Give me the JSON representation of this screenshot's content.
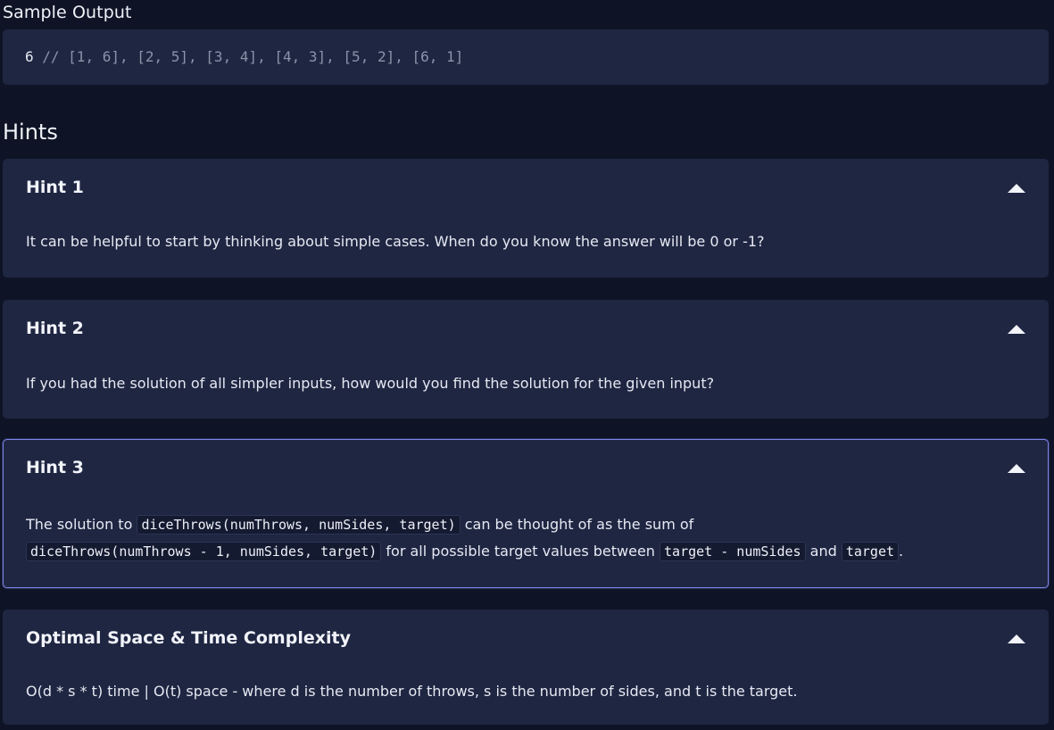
{
  "sample_output": {
    "label": "Sample Output",
    "code_value": "6",
    "code_comment": " // [1, 6], [2, 5], [3, 4], [4, 3], [5, 2], [6, 1]"
  },
  "hints": {
    "heading": "Hints",
    "hint1": {
      "title": "Hint 1",
      "text": "It can be helpful to start by thinking about simple cases. When do you know the answer will be 0 or -1?"
    },
    "hint2": {
      "title": "Hint 2",
      "text": "If you had the solution of all simpler inputs, how would you find the solution for the given input?"
    },
    "hint3": {
      "title": "Hint 3",
      "text_1": "The solution to ",
      "code_1": "diceThrows(numThrows, numSides, target)",
      "text_2": " can be thought of as the sum of ",
      "code_2": "diceThrows(numThrows - 1, numSides, target)",
      "text_3": " for all possible target values between ",
      "code_3": "target - numSides",
      "text_4": " and ",
      "code_4": "target",
      "text_5": "."
    },
    "complexity": {
      "title": "Optimal Space & Time Complexity",
      "text": "O(d * s * t) time | O(t) space - where d is the number of throws, s is the number of sides, and t is the target."
    }
  },
  "icons": {
    "toggle": "caret-up-icon"
  },
  "colors": {
    "background": "#0e1426",
    "card": "#1f2642",
    "focus_border": "#7b83e6"
  }
}
